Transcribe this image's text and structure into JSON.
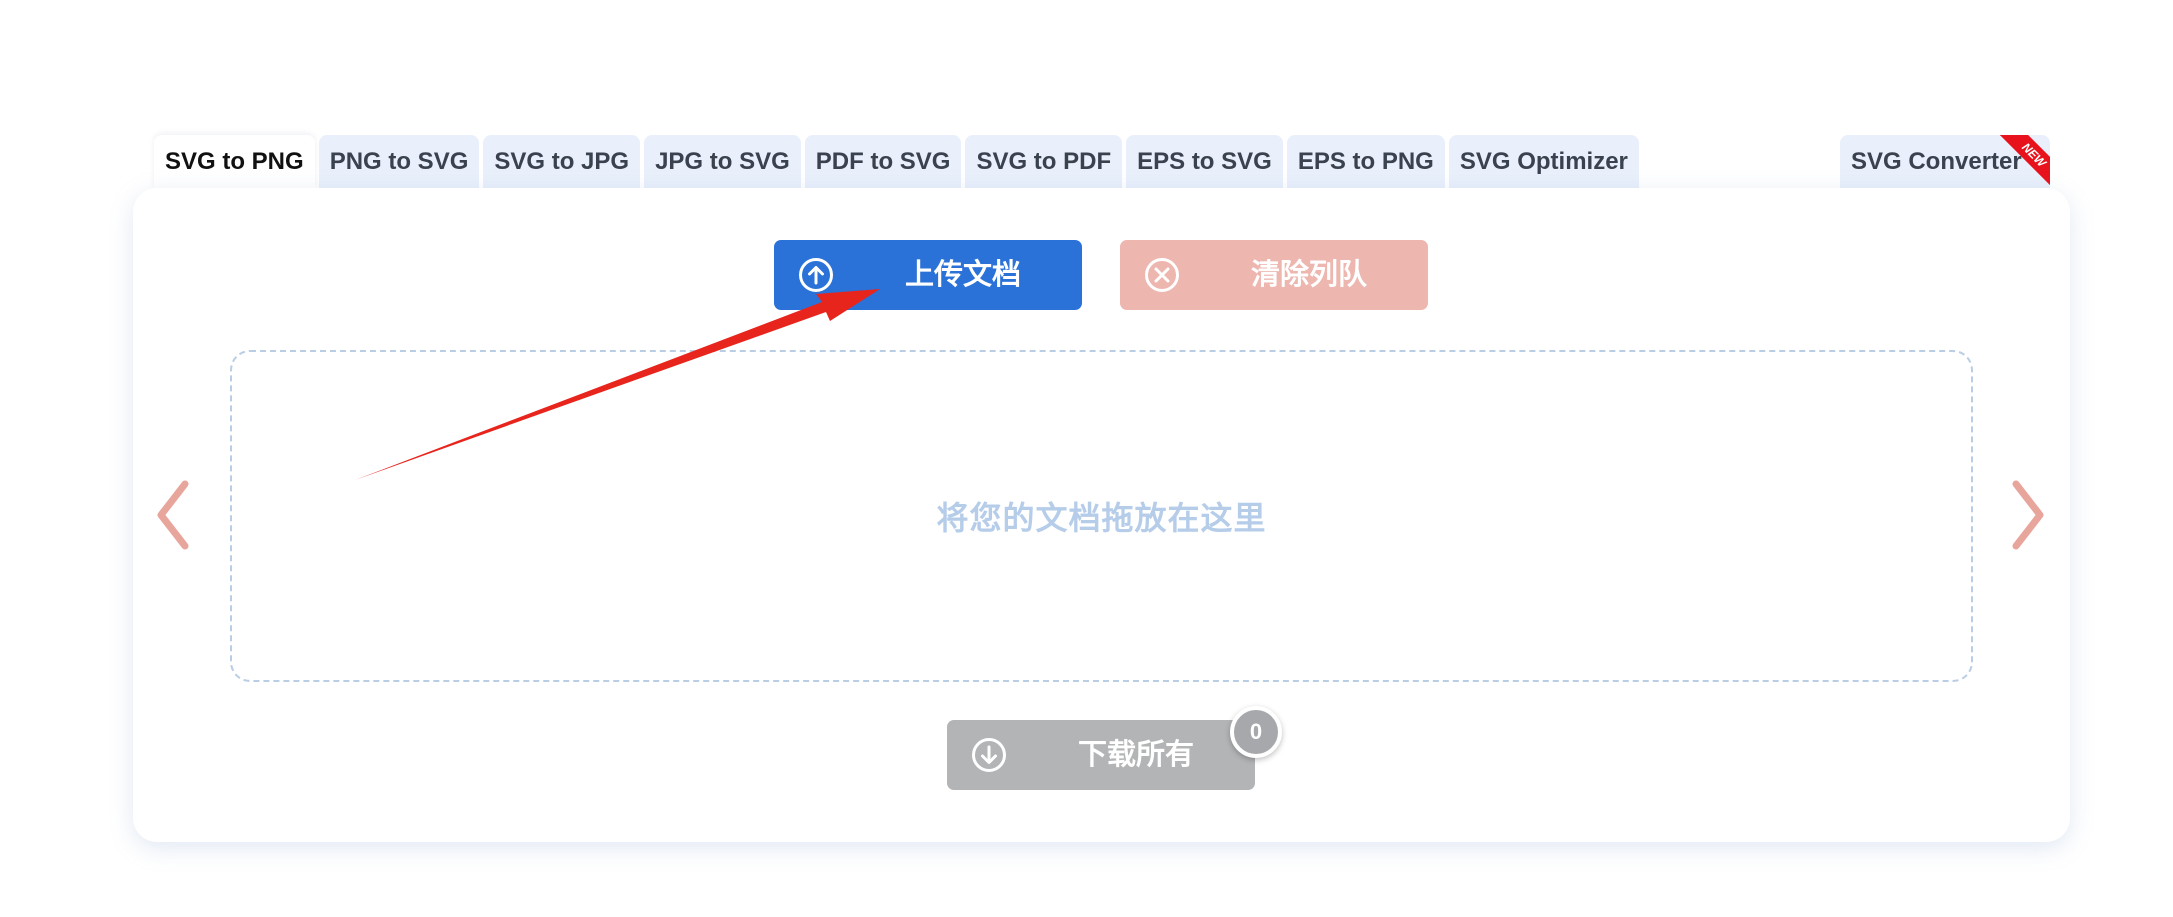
{
  "tabs": [
    {
      "label": "SVG to PNG",
      "active": true
    },
    {
      "label": "PNG to SVG",
      "active": false
    },
    {
      "label": "SVG to JPG",
      "active": false
    },
    {
      "label": "JPG to SVG",
      "active": false
    },
    {
      "label": "PDF to SVG",
      "active": false
    },
    {
      "label": "SVG to PDF",
      "active": false
    },
    {
      "label": "EPS to SVG",
      "active": false
    },
    {
      "label": "EPS to PNG",
      "active": false
    },
    {
      "label": "SVG Optimizer",
      "active": false
    }
  ],
  "extra_tab": {
    "label": "SVG Converter",
    "ribbon": "NEW"
  },
  "toolbar": {
    "upload_label": "上传文档",
    "clear_label": "清除列队",
    "upload_icon": "arrow-up-circle-icon",
    "clear_icon": "x-circle-icon"
  },
  "dropzone": {
    "text": "将您的文档拖放在这里"
  },
  "download": {
    "label": "下载所有",
    "count": "0",
    "icon": "arrow-down-circle-icon"
  },
  "nav": {
    "prev_icon": "chevron-left-icon",
    "next_icon": "chevron-right-icon"
  },
  "colors": {
    "upload": "#2a71d8",
    "clear": "#edb6af",
    "download": "#b2b4b6",
    "chevron": "#e8a59c",
    "annotation_arrow": "#e8251c",
    "ribbon": "#e8121d"
  }
}
